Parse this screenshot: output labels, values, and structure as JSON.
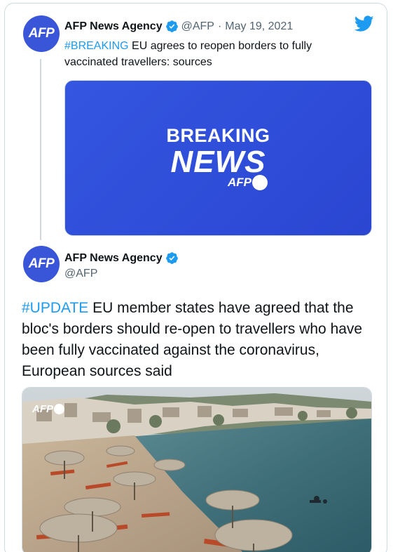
{
  "tweet1": {
    "avatar_text": "AFP",
    "author": "AFP News Agency",
    "handle": "@AFP",
    "separator": "·",
    "date": "May 19, 2021",
    "hashtag": "#BREAKING",
    "text": " EU agrees to reopen borders to fully vaccinated travellers: sources",
    "card": {
      "line1": "BREAKING",
      "line2": "NEWS",
      "logo_text": "AFP"
    }
  },
  "tweet2": {
    "avatar_text": "AFP",
    "author": "AFP News Agency",
    "handle": "@AFP",
    "hashtag": "#UPDATE",
    "text": " EU member states have agreed that the bloc's borders should re-open to travellers who have been fully vaccinated against the coronavirus, European sources said",
    "photo_logo_text": "AFP"
  },
  "colors": {
    "accent": "#1d9bf0",
    "avatar_bg": "#3a56d8",
    "card_bg": "#2f4ed8",
    "border": "#cfd9de",
    "muted_text": "#536471"
  },
  "icons": {
    "brand": "twitter-bird-icon",
    "verified": "verified-badge-icon"
  }
}
